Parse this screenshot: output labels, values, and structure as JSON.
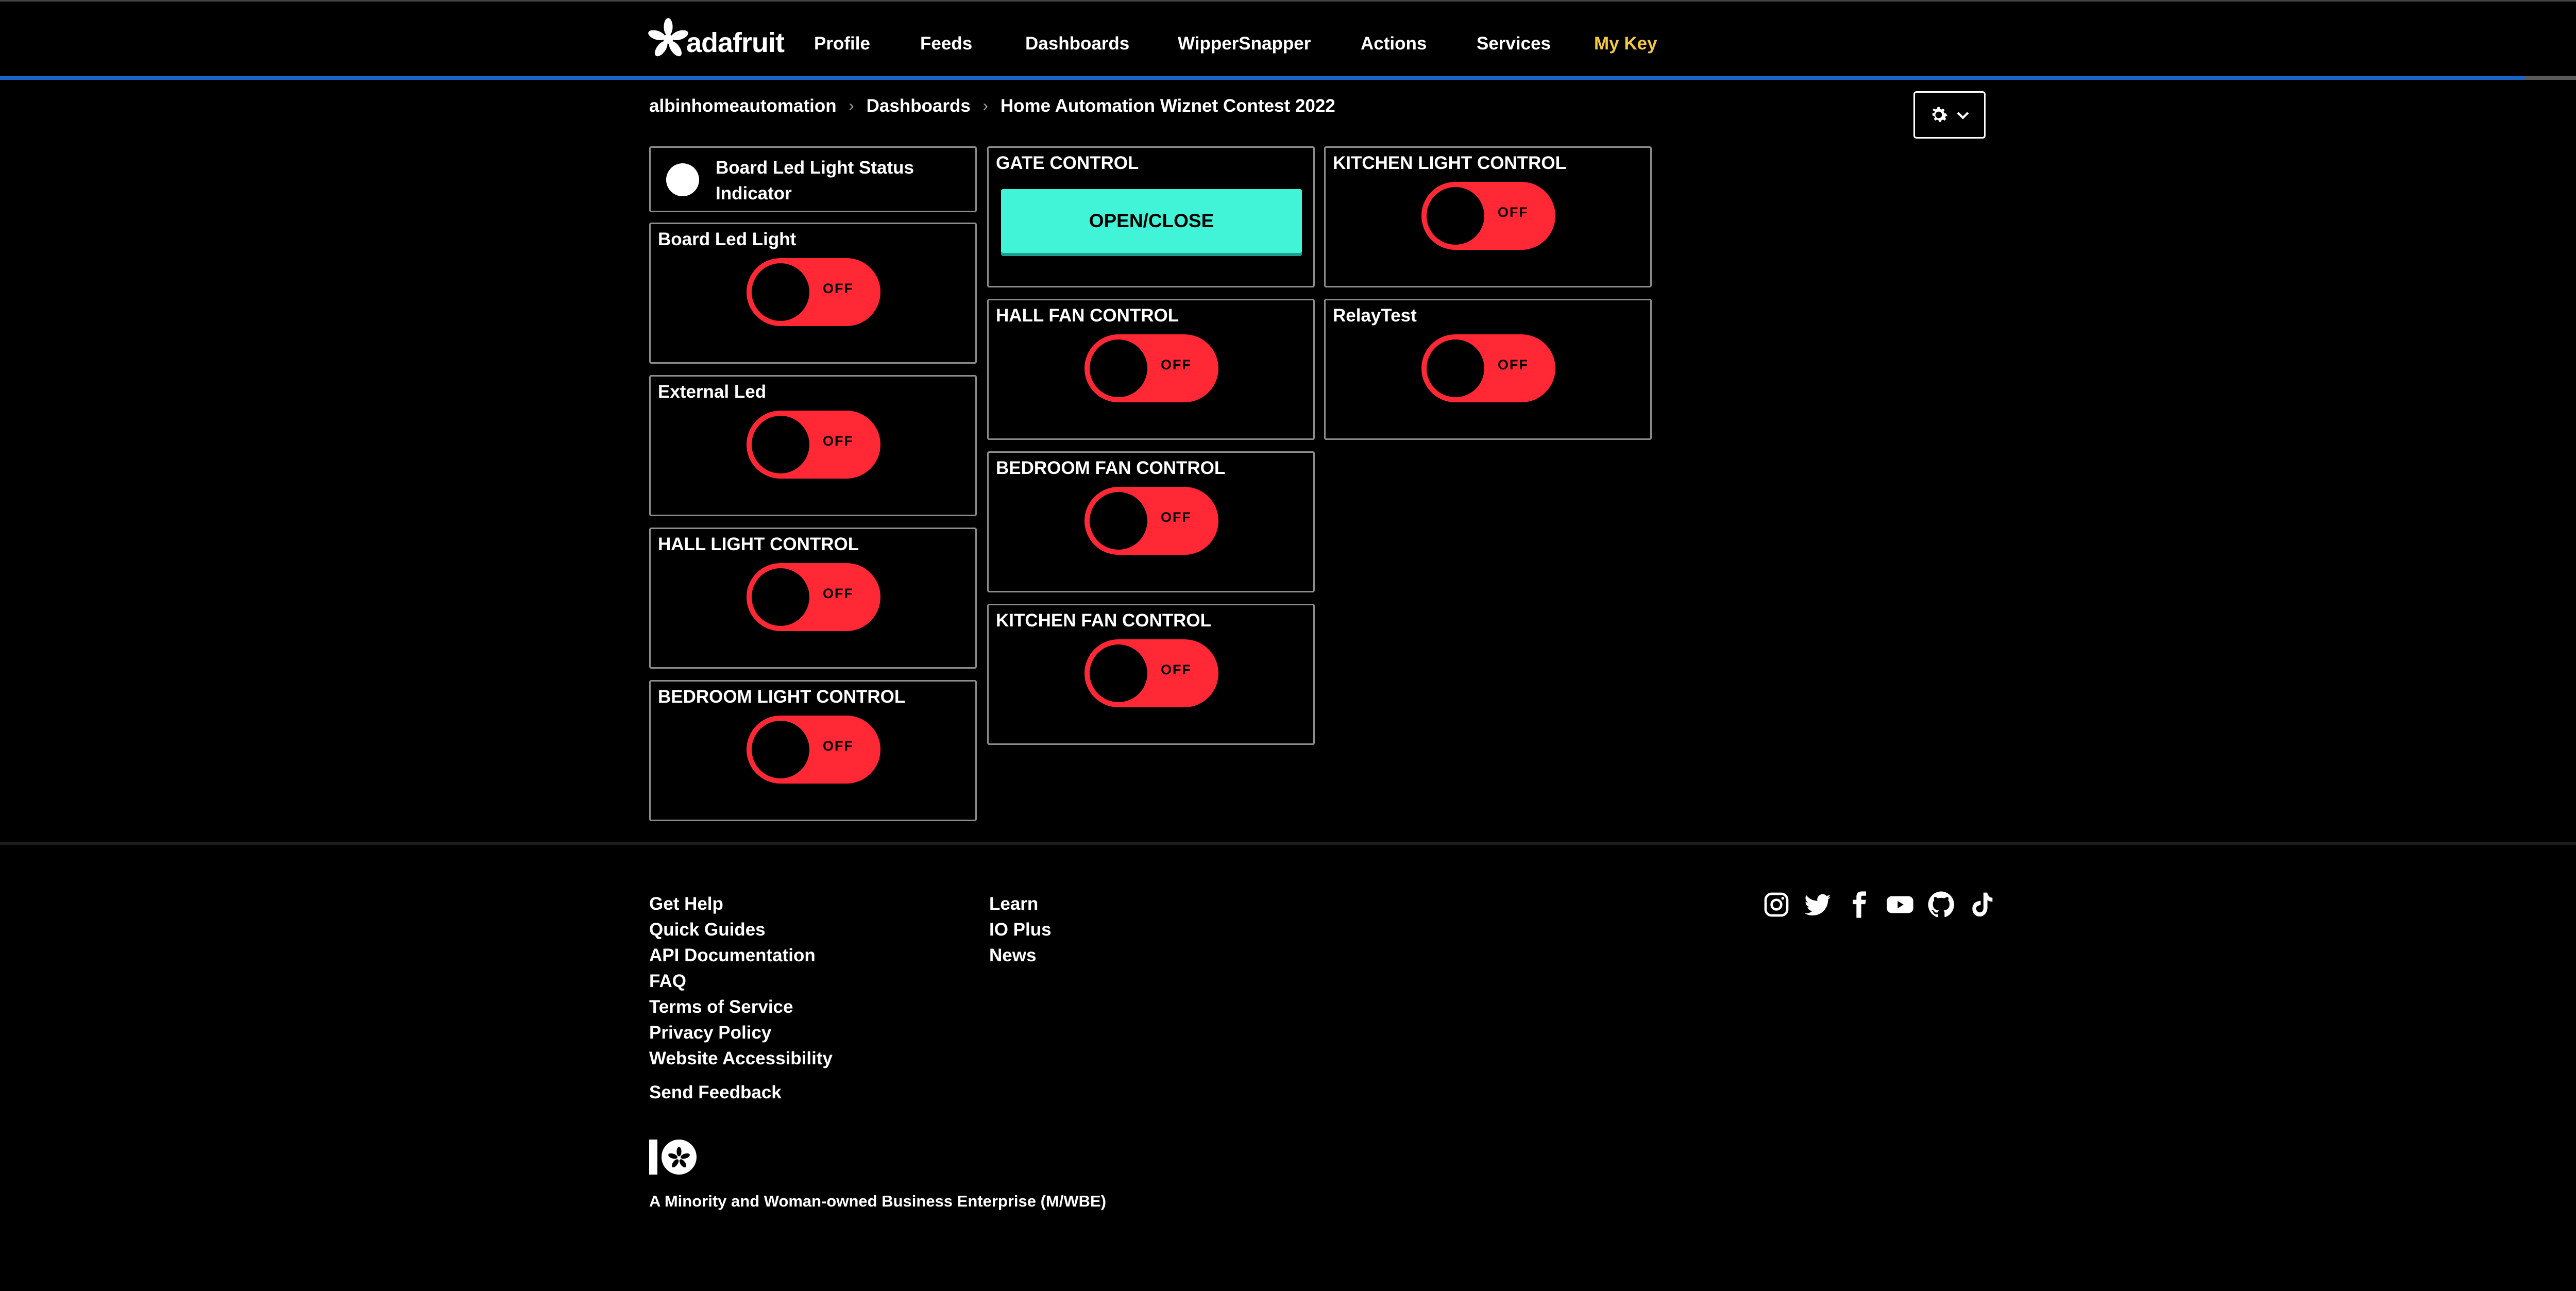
{
  "brand": {
    "name": "adafruit"
  },
  "nav": {
    "items": [
      {
        "label": "Profile"
      },
      {
        "label": "Feeds"
      },
      {
        "label": "Dashboards"
      },
      {
        "label": "WipperSnapper"
      },
      {
        "label": "Actions"
      },
      {
        "label": "Services"
      }
    ],
    "my_key": "My Key"
  },
  "breadcrumb": {
    "user": "albinhomeautomation",
    "section": "Dashboards",
    "current": "Home Automation Wiznet Contest 2022"
  },
  "blocks": {
    "indicator": {
      "label": "Board Led Light Status Indicator",
      "state": "off"
    },
    "board_led": {
      "title": "Board Led Light",
      "state": "OFF"
    },
    "external_led": {
      "title": "External Led",
      "state": "OFF"
    },
    "hall_light": {
      "title": "HALL LIGHT CONTROL",
      "state": "OFF"
    },
    "bedroom_light": {
      "title": "BEDROOM LIGHT CONTROL",
      "state": "OFF"
    },
    "gate": {
      "title": "GATE CONTROL",
      "button_label": "OPEN/CLOSE"
    },
    "hall_fan": {
      "title": "HALL FAN CONTROL",
      "state": "OFF"
    },
    "bedroom_fan": {
      "title": "BEDROOM FAN CONTROL",
      "state": "OFF"
    },
    "kitchen_fan": {
      "title": "KITCHEN FAN CONTROL",
      "state": "OFF"
    },
    "kitchen_light": {
      "title": "KITCHEN LIGHT CONTROL",
      "state": "OFF"
    },
    "relay_test": {
      "title": "RelayTest",
      "state": "OFF"
    }
  },
  "footer": {
    "col1": [
      "Get Help",
      "Quick Guides",
      "API Documentation",
      "FAQ",
      "Terms of Service",
      "Privacy Policy",
      "Website Accessibility"
    ],
    "feedback": "Send Feedback",
    "col2": [
      "Learn",
      "IO Plus",
      "News"
    ],
    "social_icons": [
      "instagram-icon",
      "twitter-icon",
      "facebook-icon",
      "youtube-icon",
      "github-icon",
      "tiktok-icon"
    ],
    "mwbe": "A Minority and Woman-owned Business Enterprise (M/WBE)"
  },
  "colors": {
    "toggle_off": "#ff2834",
    "momentary_button": "#42f4d7",
    "my_key": "#f5c842",
    "nav_accent_line": "#1a63c7"
  }
}
